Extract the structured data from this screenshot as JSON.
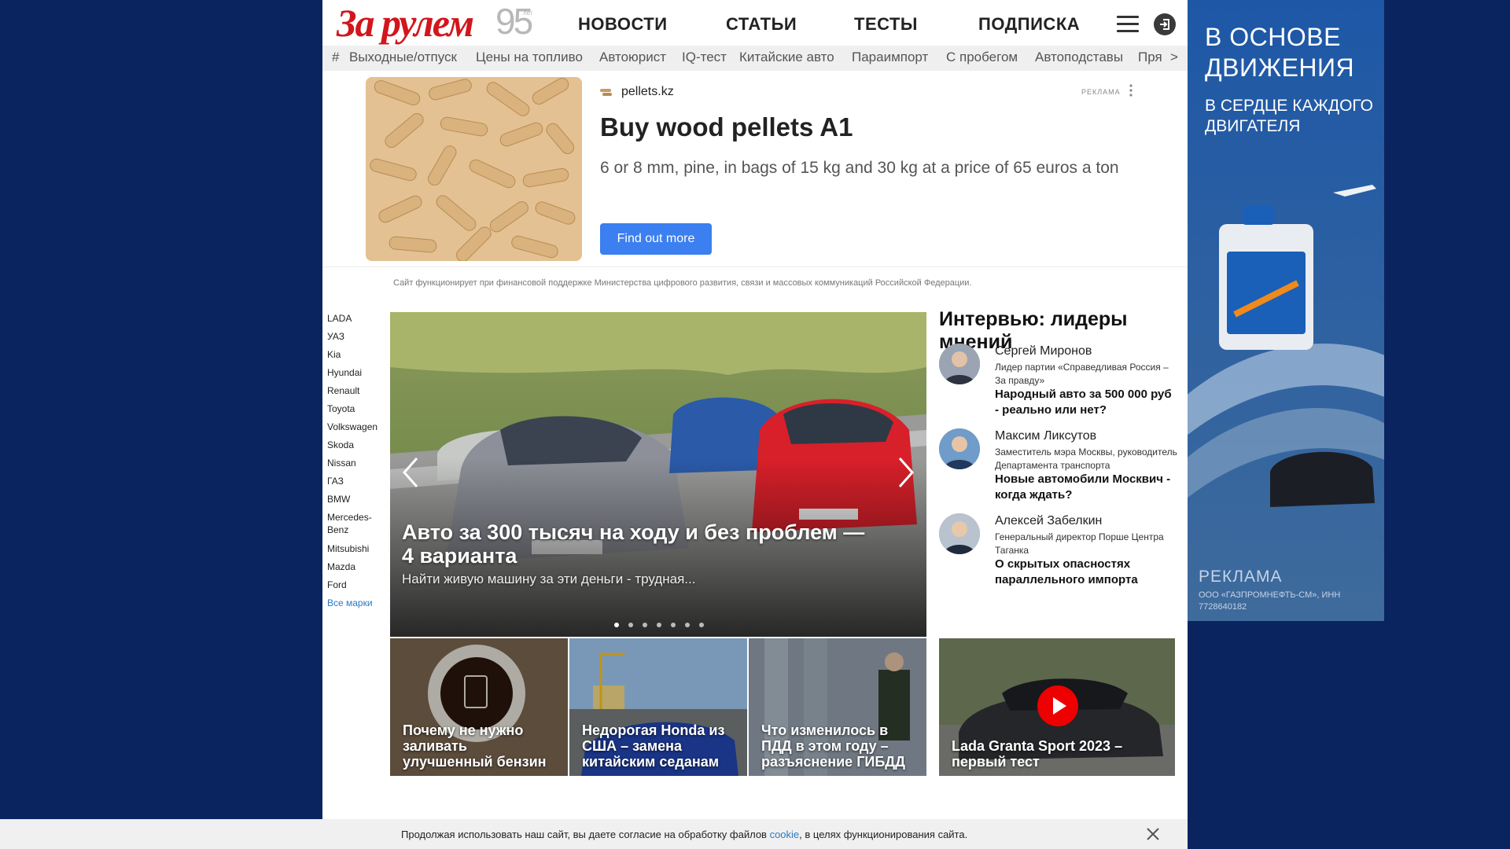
{
  "header": {
    "logo_text": "За рулем",
    "logo_number": "95",
    "logo_suffix": "лет",
    "nav": [
      "НОВОСТИ",
      "СТАТЬИ",
      "ТЕСТЫ",
      "ПОДПИСКА"
    ]
  },
  "tags": {
    "hash": "#",
    "items": [
      "Выходные/отпуск",
      "Цены на топливо",
      "Автоюрист",
      "IQ-тест",
      "Китайские авто",
      "Параимпорт",
      "С пробегом",
      "Автоподставы",
      "Пря"
    ],
    "next": ">"
  },
  "ad": {
    "domain": "pellets.kz",
    "label": "РЕКЛАМА",
    "title": "Buy wood pellets A1",
    "description": "6 or 8 mm, pine, in bags of 15 kg and 30 kg at a price of 65 euros a ton",
    "button": "Find out more"
  },
  "notice": "Сайт функционирует при финансовой поддержке Министерства цифрового развития, связи и массовых коммуникаций Российской Федерации.",
  "brands": [
    "LADA",
    "УАЗ",
    "Kia",
    "Hyundai",
    "Renault",
    "Toyota",
    "Volkswagen",
    "Skoda",
    "Nissan",
    "ГАЗ",
    "BMW",
    "Mercedes-Benz",
    "Mitsubishi",
    "Mazda",
    "Ford"
  ],
  "brands_all": "Все марки",
  "slider": {
    "title": "Авто за 300 тысяч на ходу и без проблем — 4 варианта",
    "subtitle": "Найти живую машину за эти деньги - трудная..."
  },
  "interviews": {
    "heading": "Интервью: лидеры мнений",
    "items": [
      {
        "name": "Сергей Миронов",
        "role": "Лидер партии «Справедливая Россия – За правду»",
        "title": "Народный авто за 500 000 руб - реально или нет?"
      },
      {
        "name": "Максим Ликсутов",
        "role": "Заместитель мэра Москвы, руководитель Департамента транспорта",
        "title": "Новые автомобили Москвич - когда ждать?"
      },
      {
        "name": "Алексей Забелкин",
        "role": "Генеральный директор Порше Центра Таганка",
        "title": "О скрытых опасностях параллельного импорта"
      }
    ]
  },
  "tiles": [
    {
      "title": "Почему не нужно заливать улучшенный бензин"
    },
    {
      "title": "Недорогая Honda из США – замена китайским седанам"
    },
    {
      "title": "Что изменилось в ПДД в этом году – разъяснение ГИБДД"
    },
    {
      "title": "Lada Granta Sport 2023 – первый тест"
    }
  ],
  "banner": {
    "headline": "В ОСНОВЕ ДВИЖЕНИЯ",
    "subline": "В СЕРДЦЕ КАЖДОГО ДВИГАТЕЛЯ",
    "label": "РЕКЛАМА",
    "small": "ООО «ГАЗПРОМНЕФТЬ-СМ», ИНН 7728640182"
  },
  "cookie": {
    "text_before": "Продолжая использовать наш сайт, вы даете согласие на обработку файлов ",
    "link": "cookie",
    "text_after": ", в целях функционирования сайта."
  }
}
